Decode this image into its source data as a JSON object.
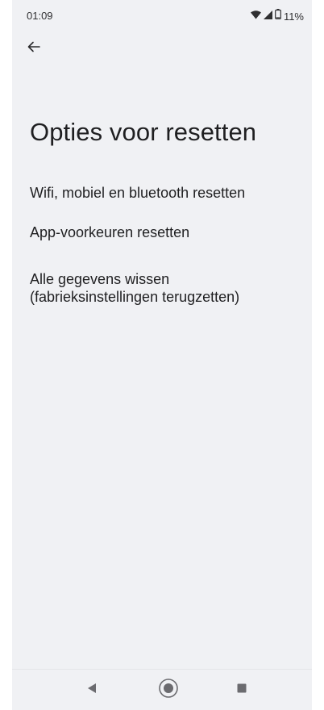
{
  "status_bar": {
    "time": "01:09",
    "battery": "11%",
    "icons": [
      "wifi-icon",
      "cellular-signal-icon",
      "battery-icon"
    ]
  },
  "header": {
    "back_icon": "back-arrow-icon"
  },
  "page": {
    "title": "Opties voor resetten"
  },
  "menu": {
    "items": [
      {
        "label": "Wifi, mobiel en bluetooth resetten"
      },
      {
        "label": "App-voorkeuren resetten"
      },
      {
        "line1": "Alle gegevens wissen",
        "line2": "(fabrieksinstellingen terugzetten)"
      }
    ]
  },
  "nav_bar": {
    "icons": [
      "nav-back-icon",
      "nav-home-icon",
      "nav-recents-icon"
    ]
  },
  "colors": {
    "background": "#f0f1f4",
    "text_primary": "#1f1f21",
    "icon_gray": "#6b6b6f"
  }
}
